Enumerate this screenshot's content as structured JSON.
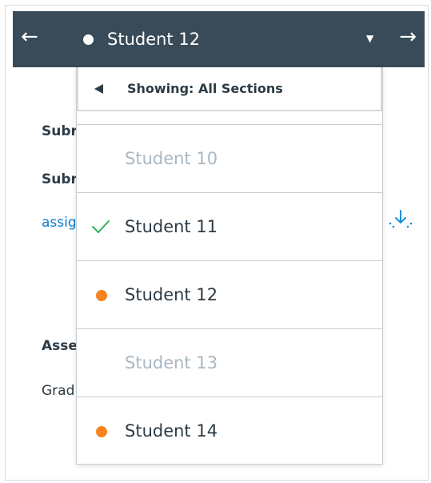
{
  "header": {
    "current_student": "Student 12",
    "prev_icon": "arrow-left-icon",
    "next_icon": "arrow-right-icon",
    "caret_icon": "caret-down-icon"
  },
  "dropdown": {
    "filter_label": "Showing: All Sections",
    "students": [
      {
        "name": "Student 10",
        "status": "none",
        "muted": true
      },
      {
        "name": "Student 11",
        "status": "graded",
        "muted": false
      },
      {
        "name": "Student 12",
        "status": "needs-grading",
        "muted": false
      },
      {
        "name": "Student 13",
        "status": "none",
        "muted": true
      },
      {
        "name": "Student 14",
        "status": "needs-grading",
        "muted": false
      }
    ]
  },
  "background": {
    "submitted_partial": "Subr",
    "submission_partial": "Subr",
    "link_partial": "assig",
    "assessment_partial": "Asse",
    "grade_partial": "Grad"
  },
  "colors": {
    "topbar": "#394b58",
    "graded_check": "#2bb160",
    "needs_grading_dot": "#f5841f",
    "muted_text": "#a9b7c3",
    "text": "#2d3b45",
    "link": "#0a7bd0"
  }
}
